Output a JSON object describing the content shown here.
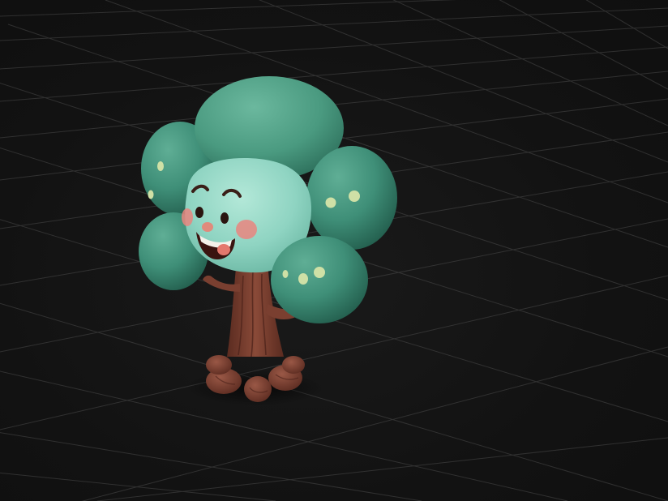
{
  "scene": {
    "background_color": "#121212",
    "grid_color": "#5a5a5a",
    "subject": "cartoon-tree-character",
    "colors": {
      "foliage": "#3f8f78",
      "foliage_dark": "#2a6a57",
      "face": "#8fd4c2",
      "trunk": "#7a3f30",
      "trunk_dark": "#54271d",
      "cheek": "#e9857f",
      "spot": "#cfe0a6"
    }
  }
}
